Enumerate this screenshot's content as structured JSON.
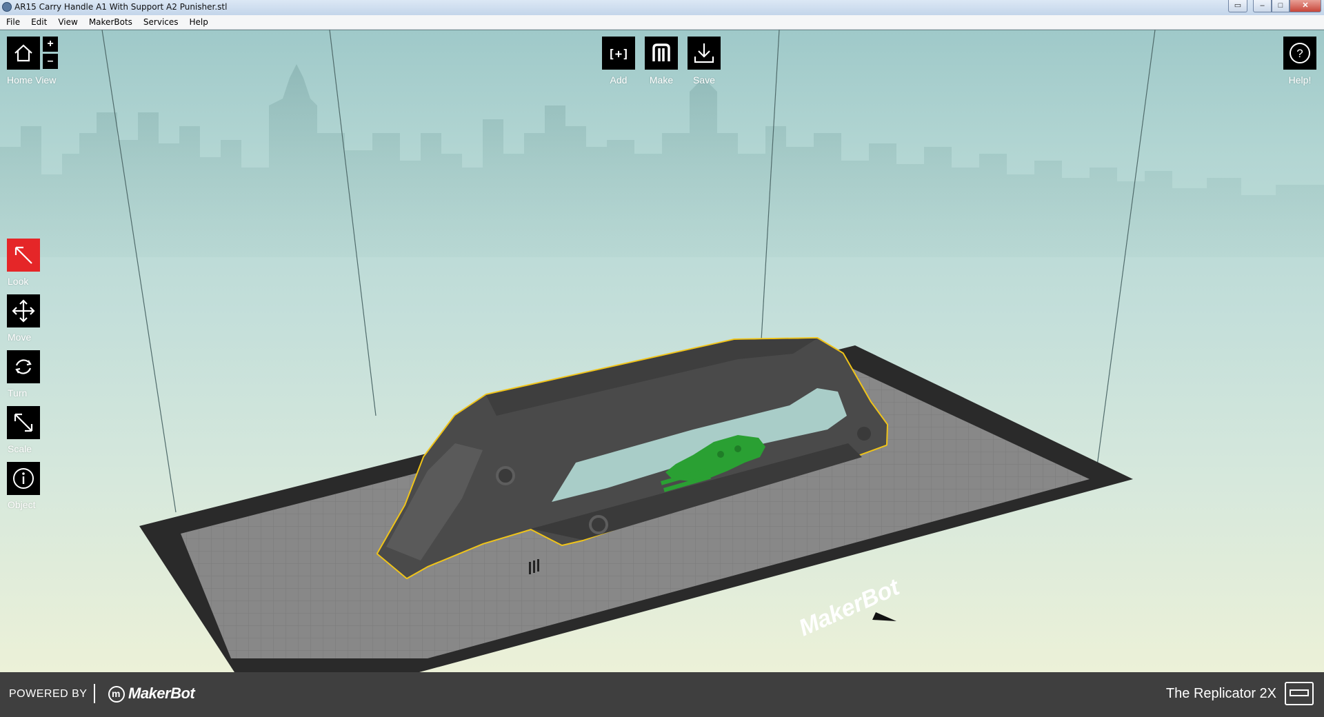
{
  "window": {
    "title": "AR15 Carry Handle A1 With Support A2 Punisher.stl",
    "controls": {
      "minimize": "–",
      "maximize": "□",
      "close": "✕"
    }
  },
  "menu": [
    "File",
    "Edit",
    "View",
    "MakerBots",
    "Services",
    "Help"
  ],
  "top_toolbar": {
    "add_label": "Add",
    "add_icon_text": "[+]",
    "make_label": "Make",
    "save_label": "Save",
    "help_label": "Help!",
    "help_icon_text": "?"
  },
  "view": {
    "home_label": "Home View",
    "zoom_in": "+",
    "zoom_out": "–"
  },
  "left_tools": [
    {
      "label": "Look",
      "icon": "look-arrow-icon",
      "active": true
    },
    {
      "label": "Move",
      "icon": "move-arrows-icon",
      "active": false
    },
    {
      "label": "Turn",
      "icon": "rotate-icon",
      "active": false
    },
    {
      "label": "Scale",
      "icon": "scale-arrow-icon",
      "active": false
    },
    {
      "label": "Object",
      "icon": "info-icon",
      "active": false
    }
  ],
  "build_plate_brand": "MakerBot",
  "footer": {
    "powered_by": "POWERED BY",
    "brand": "MakerBot",
    "brand_mark": "m",
    "printer": "The Replicator 2X"
  },
  "colors": {
    "active_tool": "#e52628",
    "selection_outline": "#f0c419",
    "model": "#4a4a4a",
    "emblem": "#2aa033",
    "footer_bg": "#3f3f3f"
  }
}
